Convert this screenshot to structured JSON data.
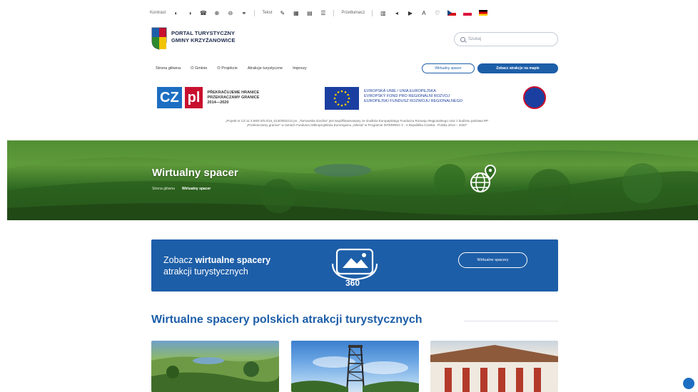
{
  "colors": {
    "primary": "#1d5ea8",
    "hero_green": "#3f7a2a",
    "eu_blue": "#1b3fa0",
    "pl_red": "#c8102e"
  },
  "accessibility_bar": {
    "label": "Kontrast",
    "font_label": "Tekst",
    "translate_label": "Przetłumacz",
    "icons": [
      "contrast-icon",
      "contrast-alt-icon",
      "phone-icon",
      "zoom-in-icon",
      "zoom-out-icon",
      "link-icon",
      "text-icon",
      "pen-icon",
      "grid-icon",
      "grid-alt-icon",
      "list-icon",
      "audio-icon",
      "play-icon",
      "font-color-icon",
      "heart-icon"
    ],
    "flags": [
      "cz",
      "pl",
      "de"
    ]
  },
  "header": {
    "brand_line1": "PORTAL TURYSTYCZNY",
    "brand_line2": "GMINY KRZYŻANOWICE",
    "search_placeholder": "Szukaj"
  },
  "nav": {
    "items": [
      "Strona główna",
      "O Gminie",
      "O Projekcie",
      "Atrakcje turystyczne",
      "Imprezy"
    ],
    "btn_outline": "Wirtualny spacer",
    "btn_fill": "Zobacz atrakcje na mapie"
  },
  "eu": {
    "czpl_line1": "PŘEKRAČUJEME HRANICE",
    "czpl_line2": "PRZEKRACZAMY GRANICE",
    "czpl_line3": "2014—2020",
    "eu_line1": "EVROPSKÁ UNIE / UNIA EUROPEJSKA",
    "eu_line2": "EVROPSKÝ FOND PRO REGIONÁLNÍ ROZVOJ",
    "eu_line3": "EUROPEJSKI FUNDUSZ ROZWOJU REGIONALNEGO",
    "project_line1": "„Projekt nr CZ.11.3.59/0.0/0.0/16_013/0002213 pn. „Tarnowska ścieżka\" jest współfinansowany ze środków Europejskiego Funduszu Rozwoju Regionalnego oraz z budżetu państwa RP",
    "project_line2": "„Przekraczamy granice\" w ramach Funduszu Mikroprojektów Euroregionu „Silesia\" w Programie INTERREG V - A Republika Czeska - Polska 2014 – 2020\""
  },
  "hero": {
    "title": "Wirtualny spacer",
    "crumb_home": "Strona główna",
    "crumb_current": "Wirtualny spacer"
  },
  "banner": {
    "text_prefix": "Zobacz ",
    "text_bold": "wirtualne spacery",
    "text_line2": "atrakcji turystycznych",
    "badge_360": "360",
    "button": "Wirtualne spacery"
  },
  "section": {
    "title": "Wirtualne spacery polskich atrakcji turystycznych"
  }
}
